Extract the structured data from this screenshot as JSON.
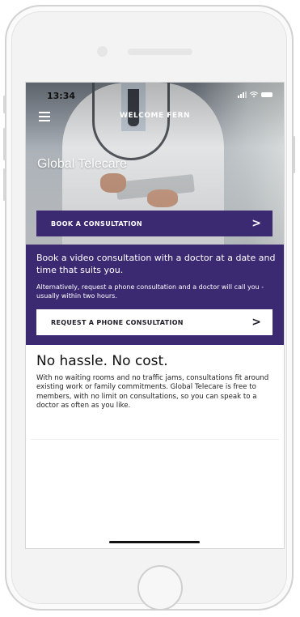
{
  "status_bar": {
    "time": "13:34",
    "icons": [
      "signal-icon",
      "wifi-icon",
      "battery-icon"
    ]
  },
  "header": {
    "menu_icon": "hamburger-menu-icon",
    "welcome": "WELCOME FERN",
    "app_title": "Global Telecare"
  },
  "actions": {
    "book_label": "BOOK A CONSULTATION",
    "book_chevron": ">",
    "phone_label": "REQUEST A PHONE CONSULTATION",
    "phone_chevron": ">"
  },
  "panel": {
    "intro": "Book a video consultation with a doctor at a date and time that suits you.",
    "alt": "Alternatively, request a phone consultation and a doctor will call you - usually within two hours."
  },
  "info": {
    "headline": "No hassle. No cost.",
    "body": "With no waiting rooms and no traffic jams, consultations fit around existing work or family commitments. Global Telecare is free to members, with no limit on consultations, so you can speak to a doctor as often as you like."
  },
  "colors": {
    "brand_purple": "#3b2a72",
    "button_white": "#ffffff",
    "text_dark": "#111111"
  }
}
